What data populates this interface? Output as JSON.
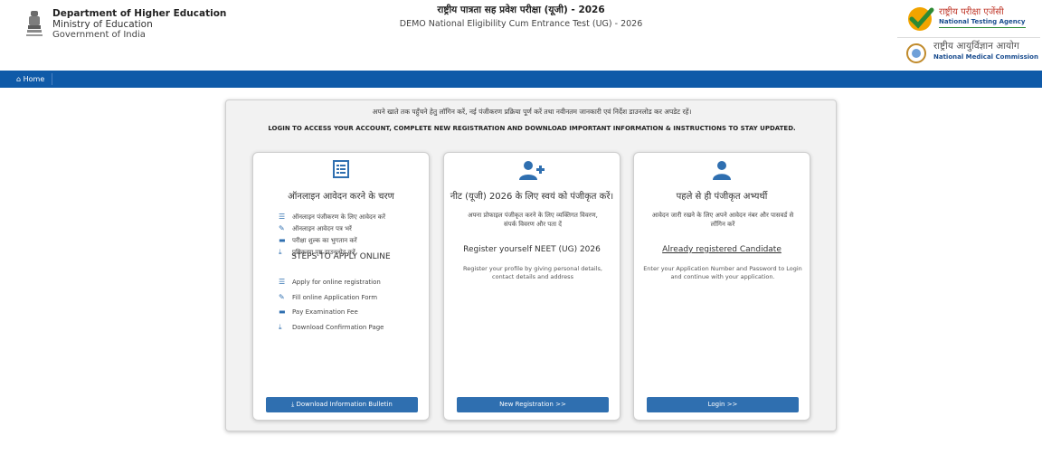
{
  "header": {
    "dept_line1": "Department of Higher Education",
    "dept_line2": "Ministry of Education",
    "dept_line3": "Government of India",
    "title_hindi": "राष्ट्रीय पात्रता सह प्रवेश परीक्षा (यूजी) - 2026",
    "title_english": "DEMO National Eligibility Cum Entrance Test (UG) - 2026",
    "nta_hindi": "राष्ट्रीय परीक्षा एजेंसी",
    "nta_english": "National Testing Agency",
    "nmc_hindi": "राष्ट्रीय आयुर्विज्ञान आयोग",
    "nmc_english": "National Medical Commission"
  },
  "nav": {
    "home_label": "Home"
  },
  "panel": {
    "info_hindi": "अपने खाते तक पहुँचने हेतु लॉगिन करें, नई पंजीकरण प्रक्रिया पूर्ण करें तथा नवीनतम जानकारी एवं निर्देश डाउनलोड कर अपडेट रहें।",
    "info_english": "LOGIN TO ACCESS YOUR ACCOUNT, COMPLETE NEW REGISTRATION AND DOWNLOAD IMPORTANT INFORMATION & INSTRUCTIONS TO STAY UPDATED."
  },
  "cards": {
    "steps": {
      "title": "ऑनलाइन आवेदन करने के चरण",
      "hindi_steps": [
        "ऑनलाइन पंजीकरण के लिए आवेदन करें",
        "ऑनलाइन आवेदन पत्र भरें",
        "परीक्षा शुल्क का भुगतान करें",
        "पुष्टिकरण पृष्ठ डाउनलोड करें"
      ],
      "english_heading": "STEPS TO APPLY ONLINE",
      "english_steps": [
        "Apply for online registration",
        "Fill online Application Form",
        "Pay Examination Fee",
        "Download Confirmation Page"
      ],
      "button": "Download Information Bulletin"
    },
    "register": {
      "title": "नीट (यूजी) 2026 के लिए स्वयं को पंजीकृत करें।",
      "desc_hindi": "अपना प्रोफाइल पंजीकृत करने के लिए व्यक्तिगत विवरण, संपर्क विवरण और पता दें",
      "heading_english": "Register yourself NEET (UG) 2026",
      "desc_english": "Register your profile by giving personal details, contact details and address",
      "button": "New Registration >>"
    },
    "login": {
      "title": "पहले से ही पंजीकृत अभ्यर्थी",
      "desc_hindi": "आवेदन जारी रखने के लिए अपने आवेदन नंबर और पासवर्ड से लॉगिन करें",
      "heading_english": "Already registered Candidate",
      "desc_english": "Enter your Application Number and Password to Login and continue with your application.",
      "button": "Login >>"
    }
  }
}
